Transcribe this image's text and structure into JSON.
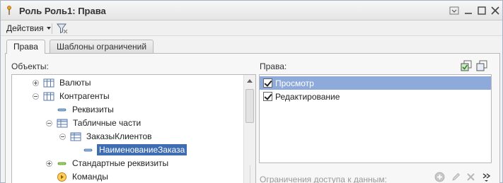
{
  "window": {
    "title": "Роль Роль1: Права",
    "icons": {
      "app": "pin-icon",
      "menu": "window-menu-icon",
      "minimize": "minimize-icon",
      "maximize": "maximize-icon",
      "close": "close-icon"
    }
  },
  "toolbar": {
    "actions_label": "Действия",
    "filter_icon": "funnel-filter-icon"
  },
  "tabs": [
    {
      "label": "Права",
      "active": true
    },
    {
      "label": "Шаблоны ограничений",
      "active": false
    }
  ],
  "objects": {
    "label": "Объекты:",
    "tree": [
      {
        "label": "Валюты",
        "expander": "plus",
        "icon": "catalog-icon",
        "selected": false
      },
      {
        "label": "Контрагенты",
        "expander": "minus",
        "icon": "catalog-icon",
        "selected": false
      },
      {
        "label": "Реквизиты",
        "expander": "none",
        "icon": "attribute-icon",
        "selected": false
      },
      {
        "label": "Табличные части",
        "expander": "minus",
        "icon": "table-icon",
        "selected": false
      },
      {
        "label": "ЗаказыКлиентов",
        "expander": "minus",
        "icon": "table-icon",
        "selected": false
      },
      {
        "label": "НаименованиеЗаказа",
        "expander": "none",
        "icon": "attribute-icon",
        "selected": true
      },
      {
        "label": "Стандартные реквизиты",
        "expander": "plus",
        "icon": "standard-attribute-icon",
        "selected": false
      },
      {
        "label": "Команды",
        "expander": "none",
        "icon": "command-icon",
        "selected": false
      }
    ]
  },
  "rights": {
    "label": "Права:",
    "tools": {
      "check_all": "check-all-icon",
      "uncheck_all": "uncheck-all-icon"
    },
    "items": [
      {
        "label": "Просмотр",
        "checked": true,
        "selected": true
      },
      {
        "label": "Редактирование",
        "checked": true,
        "selected": false
      }
    ]
  },
  "restrictions": {
    "label": "Ограничения доступа к данным:",
    "tools": {
      "add": "add-icon",
      "edit": "pencil-icon",
      "delete": "delete-icon",
      "more": "more-chevron-icon"
    }
  },
  "colors": {
    "selection_tree": "#3f6db3",
    "selection_list": "#8eaadb",
    "window_bg": "#f2f2f2"
  }
}
